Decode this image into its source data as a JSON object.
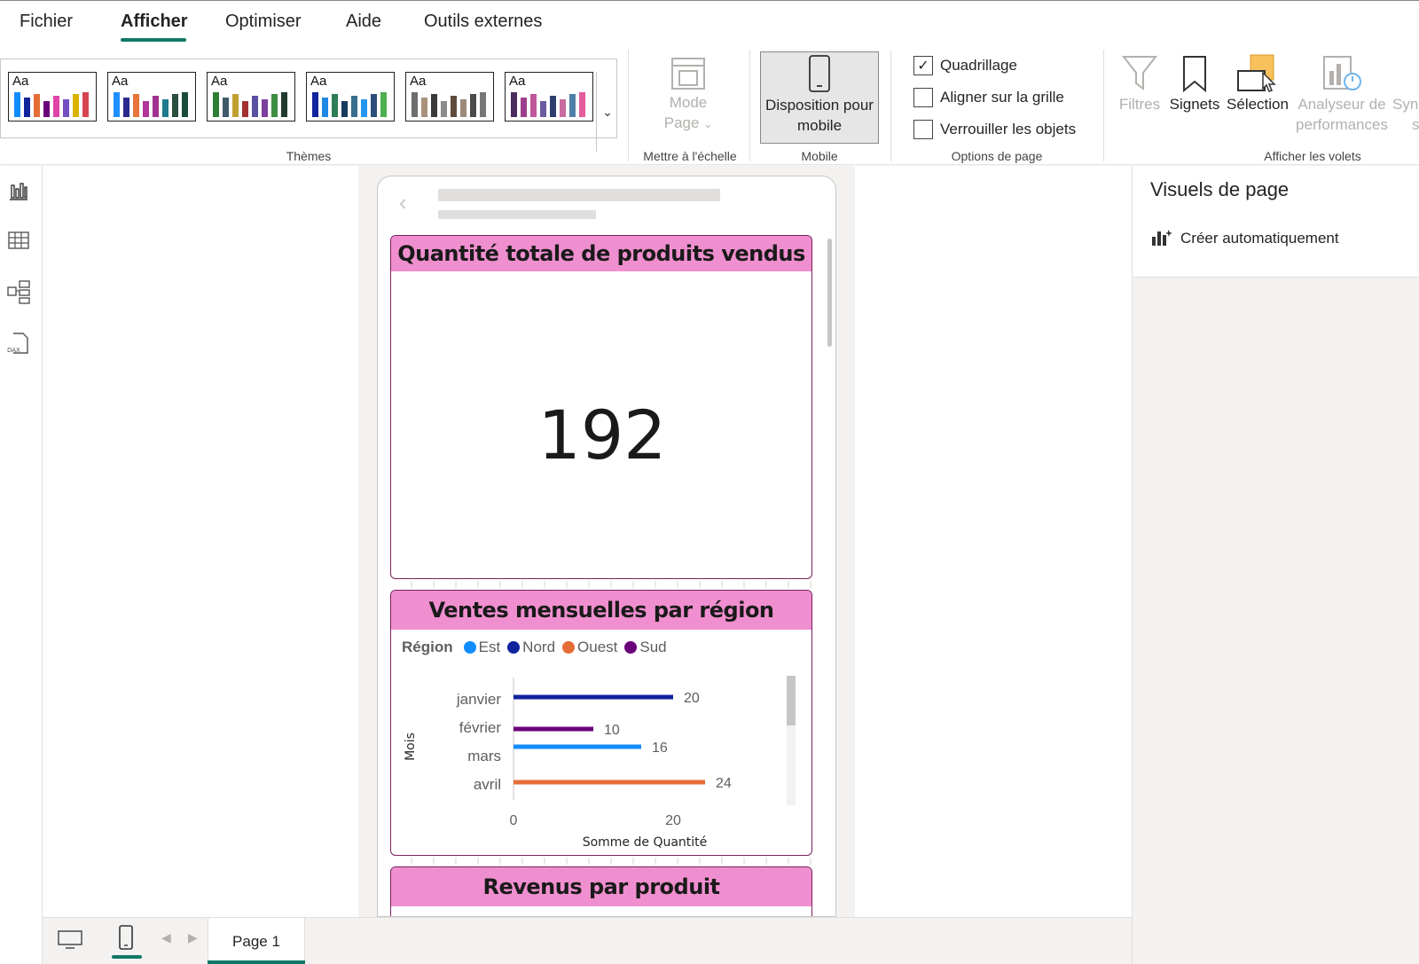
{
  "menu": {
    "items": [
      "Fichier",
      "Afficher",
      "Optimiser",
      "Aide",
      "Outils externes"
    ],
    "active": "Afficher"
  },
  "ribbon": {
    "themes_label": "Thèmes",
    "theme_aa": "Aa",
    "theme_palettes": [
      [
        "#118DFF",
        "#12239E",
        "#E66C37",
        "#6B007B",
        "#E044A7",
        "#744EC2",
        "#D9B300",
        "#D64550"
      ],
      [
        "#1E90FF",
        "#2B2A8C",
        "#E8743B",
        "#B3349A",
        "#A03290",
        "#1F7A8C",
        "#2C4E3F",
        "#194B3A"
      ],
      [
        "#2E7D32",
        "#405A6B",
        "#C0A030",
        "#A33030",
        "#5A4FA0",
        "#7B3F9E",
        "#3E8E41",
        "#1F3B2D"
      ],
      [
        "#12239E",
        "#1E88E5",
        "#2E7D57",
        "#183A5C",
        "#3A6E8F",
        "#2196F3",
        "#2C4E7A",
        "#4CAF50"
      ],
      [
        "#6E6E6E",
        "#A8907A",
        "#3A3A3A",
        "#8A8A8A",
        "#5E4B3C",
        "#9C8B7A",
        "#4A4A4A",
        "#777777"
      ],
      [
        "#4B2C5E",
        "#9C3E8E",
        "#C0569B",
        "#6A5A9E",
        "#2E3F6E",
        "#C76A9E",
        "#4D7FA8",
        "#E35C9E"
      ]
    ],
    "mode_page_line1": "Mode",
    "mode_page_line2": "Page",
    "scale_label": "Mettre à l'échelle",
    "mobile_btn_line1": "Disposition pour",
    "mobile_btn_line2": "mobile",
    "mobile_label": "Mobile",
    "options": [
      {
        "label": "Quadrillage",
        "checked": true
      },
      {
        "label": "Aligner sur la grille",
        "checked": false
      },
      {
        "label": "Verrouiller les objets",
        "checked": false
      }
    ],
    "page_options_label": "Options de page",
    "filters": "Filtres",
    "bookmarks": "Signets",
    "selection": "Sélection",
    "perf_line1": "Analyseur de",
    "perf_line2": "performances",
    "sync_line1": "Sync",
    "sync_line2": "s",
    "panes_label": "Afficher les volets"
  },
  "tiles": {
    "kpi": {
      "title": "Quantité totale de produits vendus",
      "value": "192"
    },
    "chart": {
      "title": "Ventes mensuelles par région",
      "legend_title": "Région"
    },
    "revenue": {
      "title": "Revenus par produit"
    }
  },
  "chart_data": {
    "type": "bar",
    "orientation": "horizontal",
    "title": "Ventes mensuelles par région",
    "xlabel": "Somme de Quantité",
    "ylabel": "Mois",
    "xlim": [
      0,
      30
    ],
    "xticks": [
      0,
      20
    ],
    "categories": [
      "janvier",
      "février",
      "mars",
      "avril"
    ],
    "series": [
      {
        "name": "Est",
        "color": "#118DFF",
        "values": [
          null,
          null,
          16,
          null
        ]
      },
      {
        "name": "Nord",
        "color": "#12239E",
        "values": [
          20,
          null,
          null,
          null
        ]
      },
      {
        "name": "Ouest",
        "color": "#E66C37",
        "values": [
          null,
          null,
          null,
          24
        ]
      },
      {
        "name": "Sud",
        "color": "#6B007B",
        "values": [
          null,
          10,
          null,
          null
        ]
      }
    ]
  },
  "bottom": {
    "page_tab": "Page 1"
  },
  "right_pane": {
    "title": "Visuels de page",
    "auto_create": "Créer automatiquement"
  }
}
